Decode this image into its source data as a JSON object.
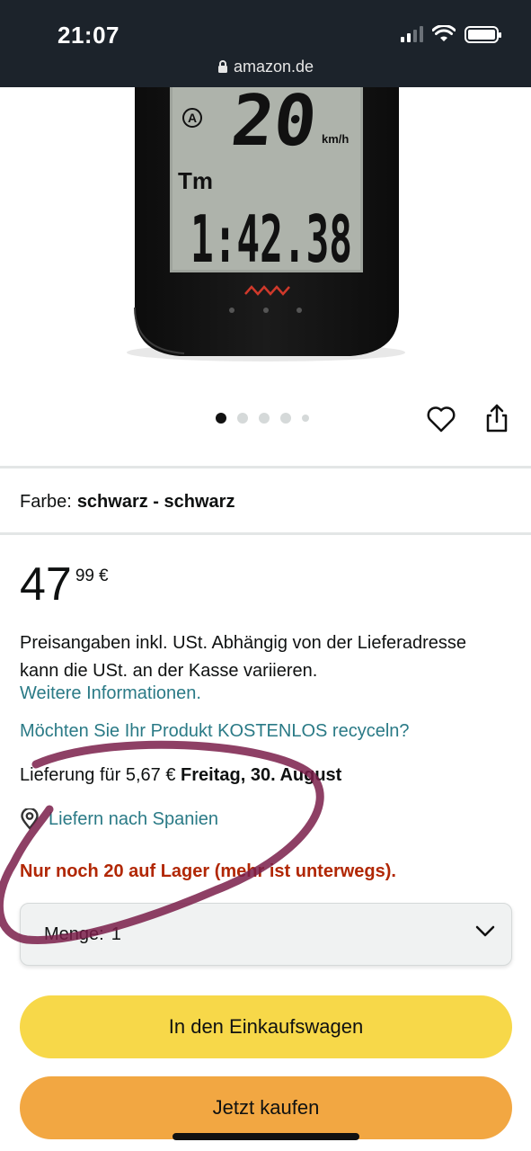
{
  "status_bar": {
    "time": "21:07",
    "url": "amazon.de",
    "icons": [
      "signal-icon",
      "wifi-icon",
      "battery-icon"
    ]
  },
  "product": {
    "display": {
      "mode_letter": "A",
      "speed": "20",
      "speed_unit": "km/h",
      "time_label": "Tm",
      "time_value": "1:42.38"
    },
    "carousel": {
      "count": 5,
      "active_index": 0
    },
    "actions": [
      "heart-icon",
      "share-icon"
    ]
  },
  "variant": {
    "label": "Farbe:",
    "value": "schwarz - schwarz"
  },
  "price": {
    "whole": "47",
    "fraction": "99",
    "currency": "€"
  },
  "tax_note": "Preisangaben inkl. USt. Abhängig von der Lieferadresse kann die USt. an der Kasse variieren.",
  "more_info_link": "Weitere Informationen.",
  "recycle_link": "Möchten Sie Ihr Produkt KOSTENLOS recyceln?",
  "delivery": {
    "prefix": "Lieferung für 5,67 €",
    "date": "Freitag, 30. August"
  },
  "ship_to": "Liefern nach Spanien",
  "stock": "Nur noch 20 auf Lager (mehr ist unterwegs).",
  "quantity": {
    "label": "Menge:",
    "value": "1"
  },
  "buttons": {
    "add_to_cart": "In den Einkaufswagen",
    "buy_now": "Jetzt kaufen"
  },
  "colors": {
    "accent_link": "#2a7a86",
    "stock_red": "#b12704",
    "cart_yellow": "#f7d849",
    "buy_orange": "#f2a742",
    "annotation": "#7a1f4a"
  }
}
